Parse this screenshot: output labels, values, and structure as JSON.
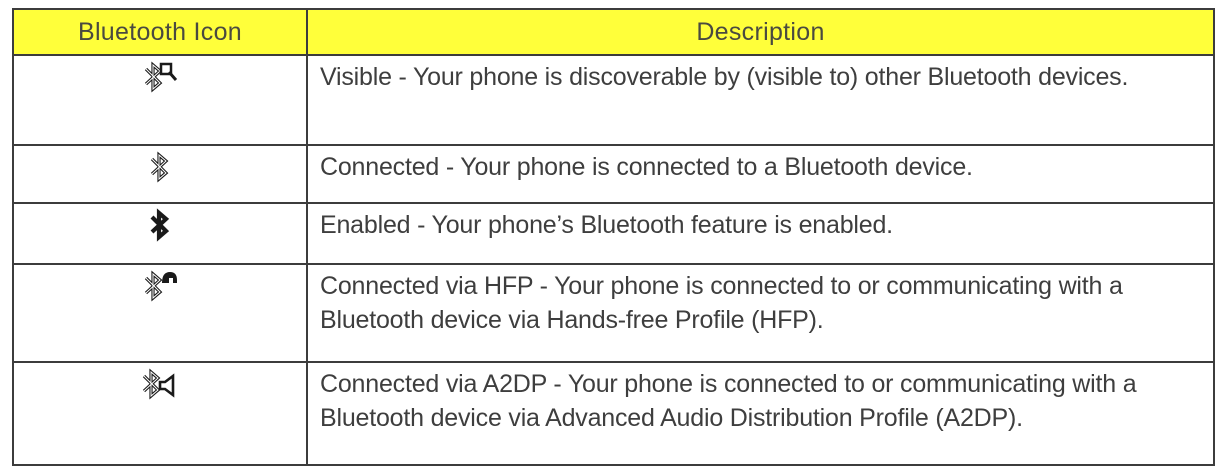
{
  "table": {
    "header": {
      "icon_col": "Bluetooth Icon",
      "desc_col": "Description"
    },
    "rows": [
      {
        "icon": "bluetooth-visible-icon",
        "description": "Visible - Your phone is discoverable by (visible to) other Bluetooth devices."
      },
      {
        "icon": "bluetooth-connected-icon",
        "description": "Connected - Your phone is connected to a Bluetooth device."
      },
      {
        "icon": "bluetooth-enabled-icon",
        "description": "Enabled - Your phone’s Bluetooth feature is enabled."
      },
      {
        "icon": "bluetooth-hfp-icon",
        "description": "Connected via HFP - Your phone is connected to or communicating with a Bluetooth device via Hands-free Profile (HFP)."
      },
      {
        "icon": "bluetooth-a2dp-icon",
        "description": "Connected via A2DP - Your phone is connected to or communicating with a Bluetooth device via Advanced Audio Distribution Profile (A2DP)."
      }
    ]
  },
  "colors": {
    "header_bg": "#ffff3a",
    "border": "#3c3c3c",
    "text": "#3e3e3e"
  }
}
